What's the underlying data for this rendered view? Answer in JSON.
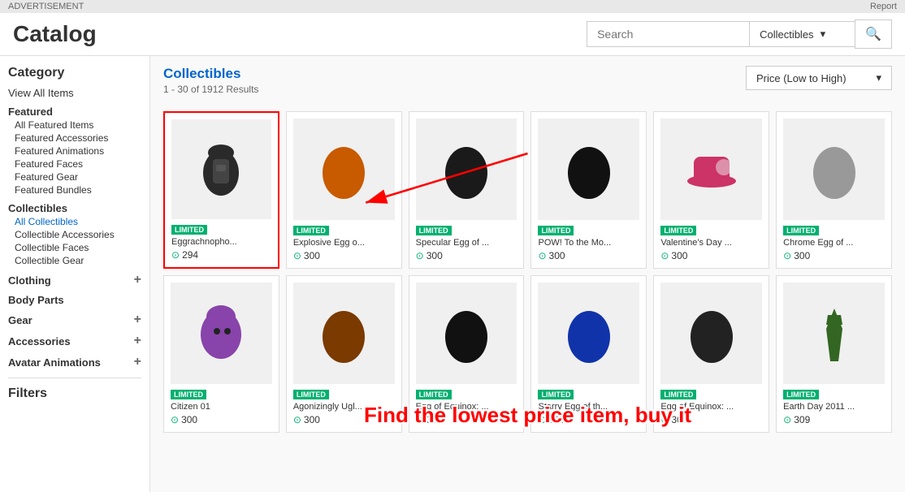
{
  "topbar": {
    "advertisement": "ADVERTISEMENT",
    "report": "Report"
  },
  "header": {
    "title": "Catalog",
    "search_placeholder": "Search",
    "dropdown_value": "Collectibles",
    "search_icon": "🔍"
  },
  "sidebar": {
    "category_title": "Category",
    "view_all": "View All Items",
    "featured_title": "Featured",
    "featured_items": [
      "All Featured Items",
      "Featured Accessories",
      "Featured Animations",
      "Featured Faces",
      "Featured Gear",
      "Featured Bundles"
    ],
    "collectibles_title": "Collectibles",
    "collectibles_items": [
      "All Collectibles",
      "Collectible Accessories",
      "Collectible Faces",
      "Collectible Gear"
    ],
    "clothing_title": "Clothing",
    "body_parts_title": "Body Parts",
    "gear_title": "Gear",
    "accessories_title": "Accessories",
    "avatar_animations_title": "Avatar Animations",
    "filters_title": "Filters"
  },
  "content": {
    "title": "Collectibles",
    "result_count": "1 - 30 of 1912 Results",
    "sort_label": "Price (Low to High)",
    "items_row1": [
      {
        "name": "Eggrachnopho...",
        "price": "294",
        "badge": "LIMITED",
        "highlighted": true,
        "color": "#2a2a2a",
        "type": "backpack"
      },
      {
        "name": "Explosive Egg o...",
        "price": "300",
        "badge": "LIMITED",
        "color": "#c85a00",
        "type": "egg_orange"
      },
      {
        "name": "Specular Egg of ...",
        "price": "300",
        "badge": "LIMITED",
        "color": "#1a1a1a",
        "type": "egg_dark"
      },
      {
        "name": "POW! To the Mo...",
        "price": "300",
        "badge": "LIMITED",
        "color": "#111",
        "type": "egg_black"
      },
      {
        "name": "Valentine's Day ...",
        "price": "300",
        "badge": "LIMITED",
        "color": "#cc3366",
        "type": "hat"
      },
      {
        "name": "Chrome Egg of ...",
        "price": "300",
        "badge": "LIMITED",
        "color": "#999",
        "type": "egg_silver"
      }
    ],
    "items_row2": [
      {
        "name": "Citizen 01",
        "price": "300",
        "badge": "LIMITED",
        "color": "#8844aa",
        "type": "head"
      },
      {
        "name": "Agonizingly Ugl...",
        "price": "300",
        "badge": "LIMITED",
        "color": "#7a3a00",
        "type": "egg_ugly"
      },
      {
        "name": "Egg of Equinox: ...",
        "price": "300",
        "badge": "LIMITED",
        "color": "#111",
        "type": "egg_equinox"
      },
      {
        "name": "Starry Egg of th...",
        "price": "300",
        "badge": "LIMITED",
        "color": "#1133aa",
        "type": "egg_starry"
      },
      {
        "name": "Egg of Equinox: ...",
        "price": "300",
        "badge": "LIMITED",
        "color": "#222",
        "type": "egg_eq2"
      },
      {
        "name": "Earth Day 2011 ...",
        "price": "309",
        "badge": "LIMITED",
        "color": "#336622",
        "type": "tie"
      }
    ],
    "overlay_text": "Find the lowest price item, buy it"
  }
}
